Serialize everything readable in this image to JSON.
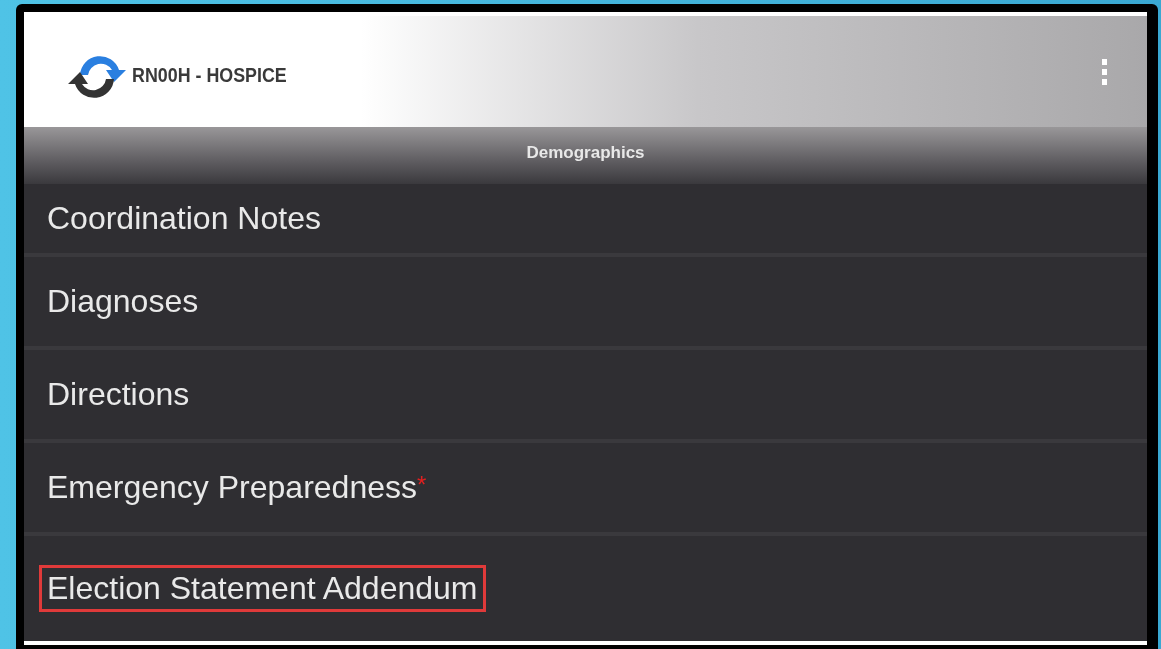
{
  "header": {
    "title": "RN00H - HOSPICE"
  },
  "section": {
    "title": "Demographics"
  },
  "items": [
    {
      "label": "Coordination Notes",
      "highlighted": false
    },
    {
      "label": "Diagnoses",
      "highlighted": false
    },
    {
      "label": "Directions",
      "highlighted": false
    },
    {
      "label": "Emergency Preparedness",
      "required_mark": "*",
      "highlighted": false
    },
    {
      "label": "Election Statement Addendum",
      "highlighted": true
    }
  ]
}
